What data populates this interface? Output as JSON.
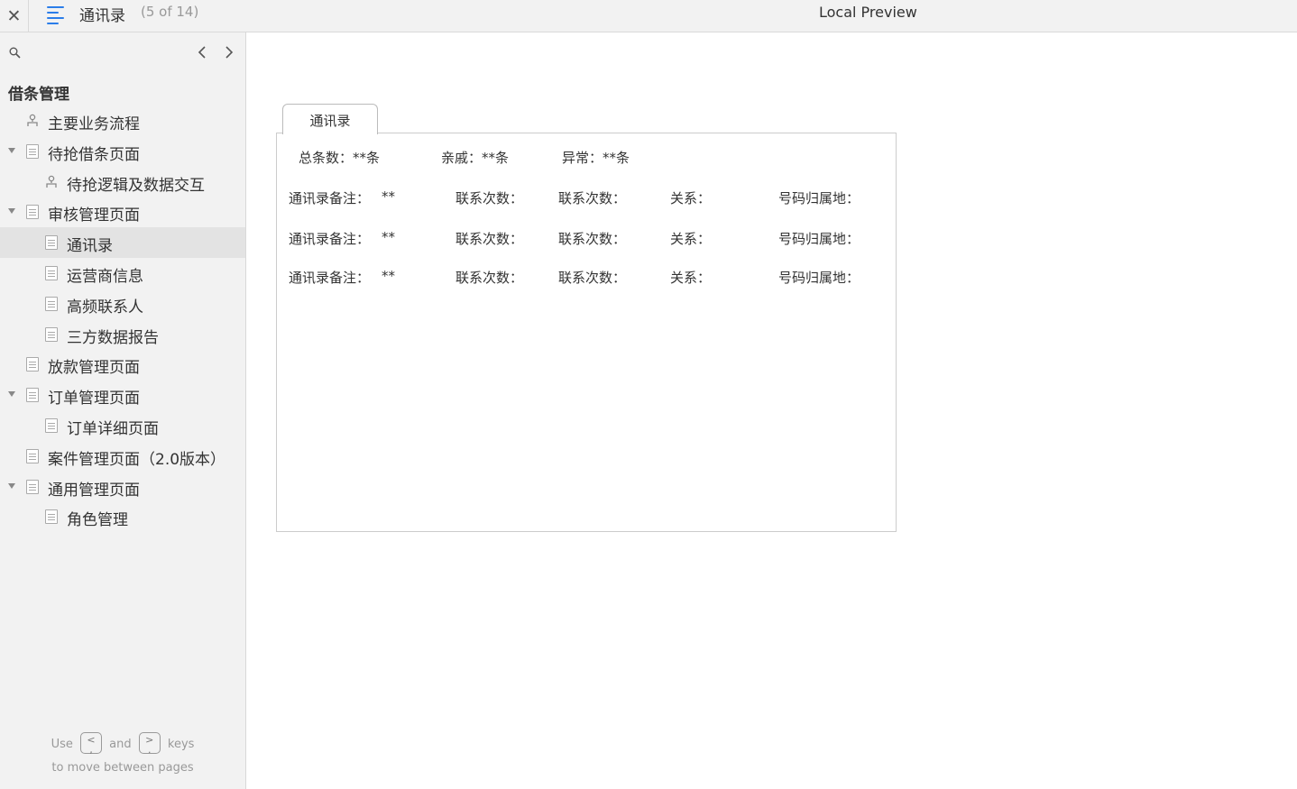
{
  "header": {
    "close_glyph": "✕",
    "page_name": "通讯录",
    "page_count": "(5 of 14)",
    "preview_label": "Local Preview"
  },
  "sidebar": {
    "section_title": "借条管理",
    "items": [
      {
        "label": "主要业务流程",
        "icon": "flow-icon",
        "level": 0,
        "expandable": false,
        "selected": false
      },
      {
        "label": "待抢借条页面",
        "icon": "page-icon",
        "level": 0,
        "expandable": true,
        "selected": false
      },
      {
        "label": "待抢逻辑及数据交互",
        "icon": "flow-icon",
        "level": 1,
        "expandable": false,
        "selected": false
      },
      {
        "label": "审核管理页面",
        "icon": "page-icon",
        "level": 0,
        "expandable": true,
        "selected": false
      },
      {
        "label": "通讯录",
        "icon": "page-icon",
        "level": 1,
        "expandable": false,
        "selected": true
      },
      {
        "label": "运营商信息",
        "icon": "page-icon",
        "level": 1,
        "expandable": false,
        "selected": false
      },
      {
        "label": "高频联系人",
        "icon": "page-icon",
        "level": 1,
        "expandable": false,
        "selected": false
      },
      {
        "label": "三方数据报告",
        "icon": "page-icon",
        "level": 1,
        "expandable": false,
        "selected": false
      },
      {
        "label": "放款管理页面",
        "icon": "page-icon",
        "level": 0,
        "expandable": false,
        "selected": false
      },
      {
        "label": "订单管理页面",
        "icon": "page-icon",
        "level": 0,
        "expandable": true,
        "selected": false
      },
      {
        "label": "订单详细页面",
        "icon": "page-icon",
        "level": 1,
        "expandable": false,
        "selected": false
      },
      {
        "label": "案件管理页面（2.0版本）",
        "icon": "page-icon",
        "level": 0,
        "expandable": false,
        "selected": false
      },
      {
        "label": "通用管理页面",
        "icon": "page-icon",
        "level": 0,
        "expandable": true,
        "selected": false
      },
      {
        "label": "角色管理",
        "icon": "page-icon",
        "level": 1,
        "expandable": false,
        "selected": false
      }
    ],
    "hint": {
      "use": "Use",
      "key_prev": "<\n,",
      "and": "and",
      "key_next": ">\n.",
      "keys": "keys",
      "line2": "to move between pages"
    }
  },
  "main": {
    "tab_label": "通讯录",
    "summary": {
      "total": "总条数：**条",
      "relatives": "亲戚：**条",
      "abnormal": "异常：**条"
    },
    "rows": [
      {
        "note": "通讯录备注：",
        "note_value": "**",
        "contacts1": "联系次数：",
        "contacts2": "联系次数：",
        "relation": "关系：",
        "location": "号码归属地："
      },
      {
        "note": "通讯录备注：",
        "note_value": "**",
        "contacts1": "联系次数：",
        "contacts2": "联系次数：",
        "relation": "关系：",
        "location": "号码归属地："
      },
      {
        "note": "通讯录备注：",
        "note_value": "**",
        "contacts1": "联系次数：",
        "contacts2": "联系次数：",
        "relation": "关系：",
        "location": "号码归属地："
      }
    ]
  },
  "colors": {
    "accent": "#2b7de9",
    "sidebar_bg": "#f2f2f2",
    "selected_bg": "#e3e3e3"
  }
}
